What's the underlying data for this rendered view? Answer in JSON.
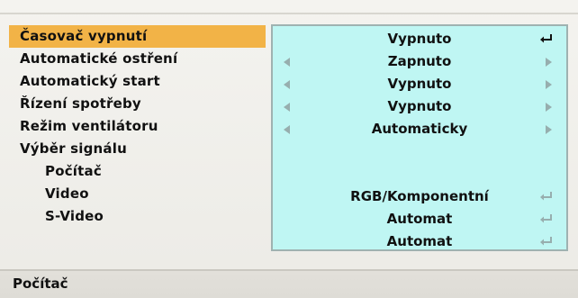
{
  "menu": {
    "items": [
      {
        "label": "Časovač vypnutí"
      },
      {
        "label": "Automatické ostření"
      },
      {
        "label": "Automatický start"
      },
      {
        "label": "Řízení spotřeby"
      },
      {
        "label": "Režim ventilátoru"
      },
      {
        "label": "Výběr signálu"
      },
      {
        "label": "Počítač"
      },
      {
        "label": "Video"
      },
      {
        "label": "S-Video"
      }
    ],
    "selected_index": 0
  },
  "values": {
    "rows": [
      {
        "value": "Vypnuto",
        "control": "enter",
        "enter_icon": "enter-return-icon"
      },
      {
        "value": "Zapnuto",
        "control": "arrows",
        "left_icon": "arrow-left-icon",
        "right_icon": "arrow-right-icon"
      },
      {
        "value": "Vypnuto",
        "control": "arrows",
        "left_icon": "arrow-left-icon",
        "right_icon": "arrow-right-icon"
      },
      {
        "value": "Vypnuto",
        "control": "arrows",
        "left_icon": "arrow-left-icon",
        "right_icon": "arrow-right-icon"
      },
      {
        "value": "Automaticky",
        "control": "arrows",
        "left_icon": "arrow-left-icon",
        "right_icon": "arrow-right-icon"
      },
      {
        "value": "",
        "control": "none"
      },
      {
        "value": "RGB/Komponentní",
        "control": "enter",
        "enter_icon": "enter-return-icon"
      },
      {
        "value": "Automat",
        "control": "enter",
        "enter_icon": "enter-return-icon"
      },
      {
        "value": "Automat",
        "control": "enter",
        "enter_icon": "enter-return-icon"
      }
    ]
  },
  "status": {
    "text": "Počítač"
  },
  "colors": {
    "selection_highlight": "#f2b347",
    "value_panel": "#bff6f3",
    "background": "#f1f0ec"
  }
}
